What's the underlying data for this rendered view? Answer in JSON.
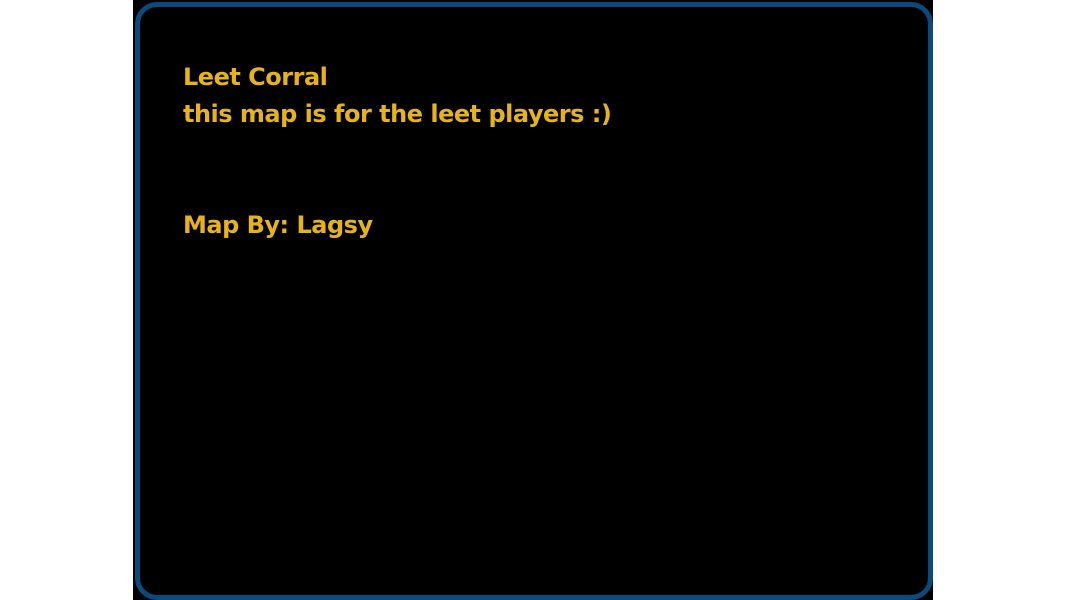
{
  "map_info": {
    "title": "Leet Corral",
    "description": "this map is for the leet players :)",
    "author_line": "Map By: Lagsy"
  },
  "colors": {
    "text": "#e8b415",
    "frame_border": "#0b4a7d",
    "background": "#000000"
  }
}
